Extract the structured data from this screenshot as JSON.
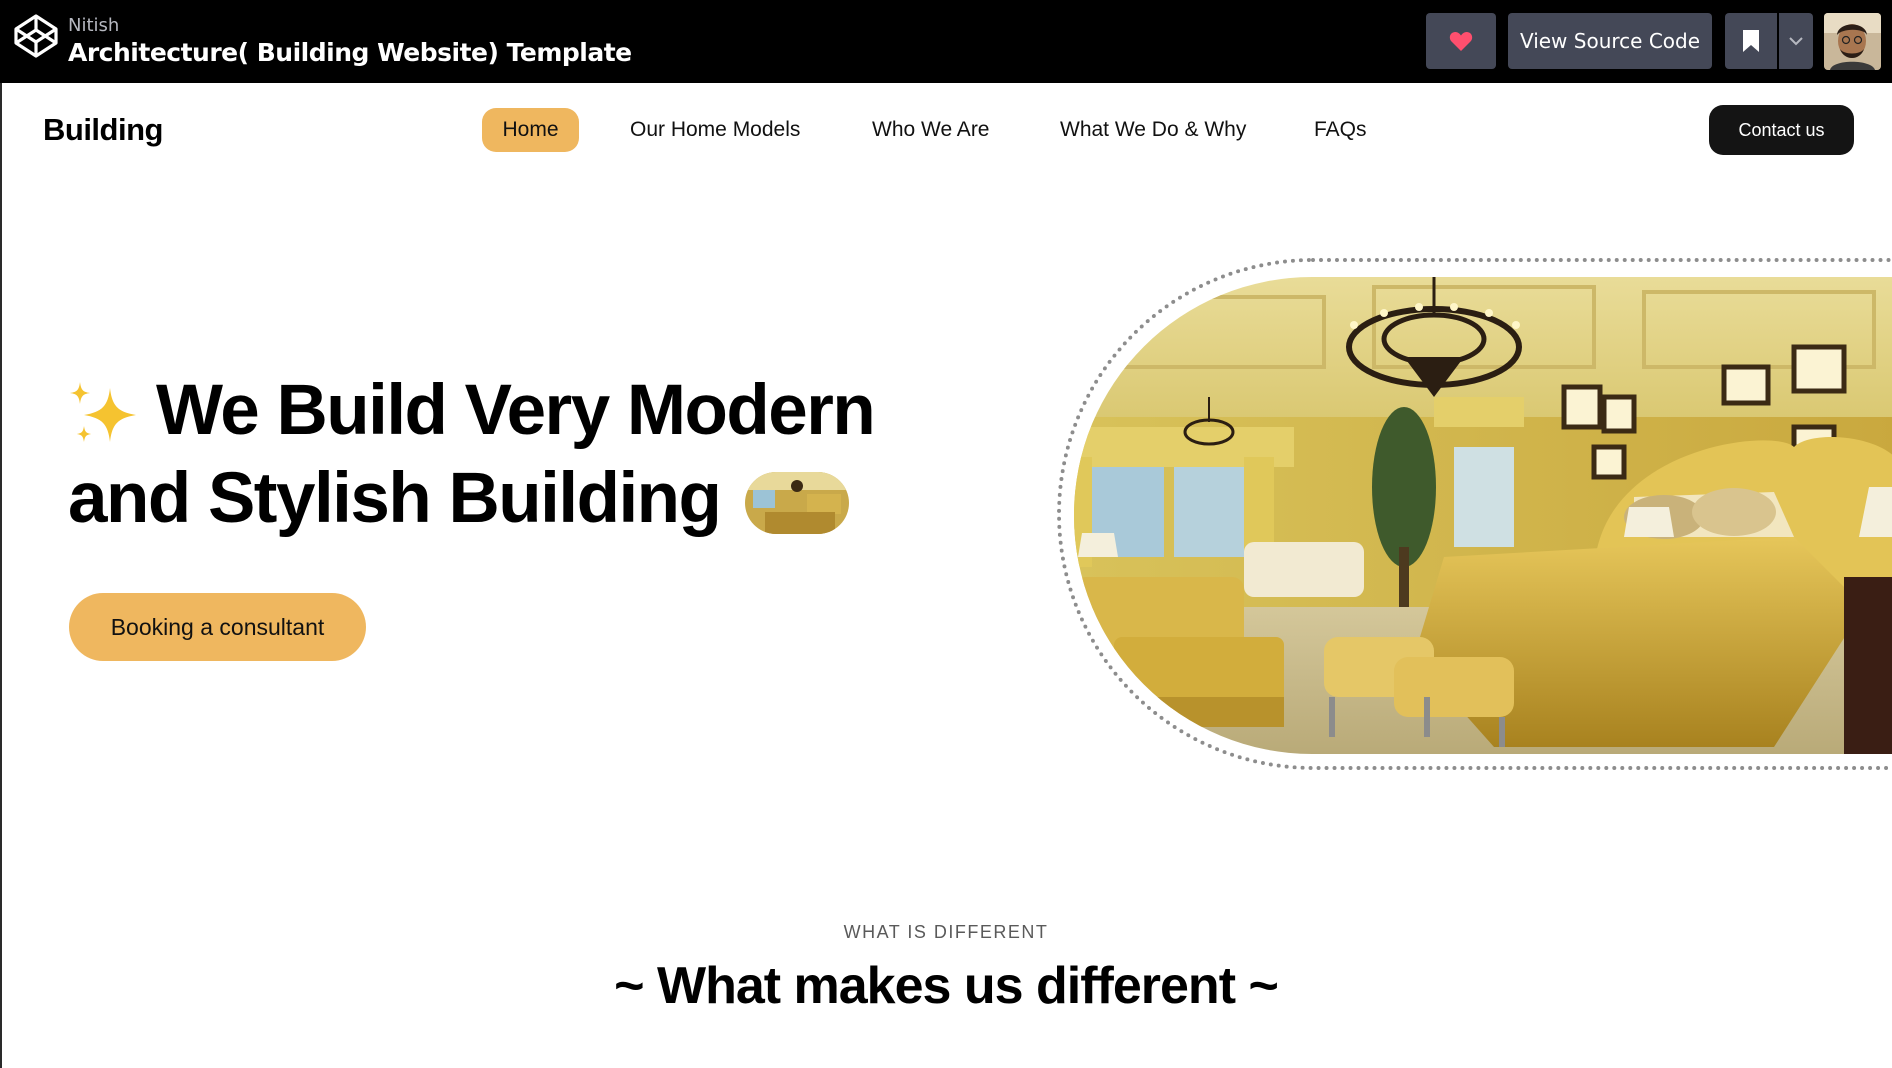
{
  "codepen": {
    "author": "Nitish",
    "title": "Architecture( Building Website) Template",
    "heart_icon": "heart-icon",
    "source_label": "View Source Code",
    "bookmark_icon": "bookmark-icon",
    "caret_icon": "chevron-down-icon"
  },
  "nav": {
    "brand": "Building",
    "links": [
      "Home",
      "Our Home Models",
      "Who We Are",
      "What We Do & Why",
      "FAQs"
    ],
    "active": "Home",
    "contact_label": "Contact us"
  },
  "hero": {
    "headline_line1": "We Build Very Modern",
    "headline_line2": "and Stylish Building",
    "cta_label": "Booking a consultant",
    "sparkle_icon": "sparkles-icon"
  },
  "different": {
    "eyebrow": "WHAT IS DIFFERENT",
    "title": "~ What makes us different ~"
  },
  "colors": {
    "accent": "#efb75f",
    "dark": "#141414",
    "codepen_bar": "#000000",
    "codepen_button": "#444857"
  }
}
